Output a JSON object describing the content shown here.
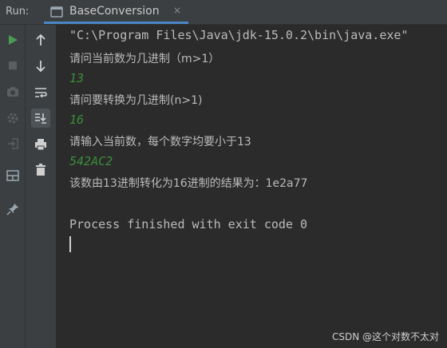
{
  "run": {
    "label": "Run:",
    "tab_title": "BaseConversion",
    "close_glyph": "×"
  },
  "toolbar_left": [
    {
      "icon": "run-icon",
      "color": "#499c54"
    },
    {
      "icon": "stop-icon"
    },
    {
      "icon": "camera-icon"
    },
    {
      "icon": "settings-icon"
    },
    {
      "icon": "login-icon"
    },
    {
      "icon": "layout-icon"
    },
    {
      "icon": "pin-icon"
    }
  ],
  "toolbar_right": [
    {
      "icon": "arrow-up-icon"
    },
    {
      "icon": "arrow-down-icon"
    },
    {
      "icon": "soft-wrap-icon"
    },
    {
      "icon": "scroll-to-end-icon"
    },
    {
      "icon": "print-icon"
    },
    {
      "icon": "trash-icon"
    }
  ],
  "console": {
    "command": "\"C:\\Program Files\\Java\\jdk-15.0.2\\bin\\java.exe\"",
    "prompt1": "请问当前数为几进制（m>1）",
    "input1": "13",
    "prompt2": "请问要转换为几进制(n>1)",
    "input2": "16",
    "prompt3": "请输入当前数，每个数字均要小于13",
    "input3": "542AC2",
    "result": "该数由13进制转化为16进制的结果为：1e2a77",
    "finish": "Process finished with exit code 0"
  },
  "colors": {
    "input": "#3a8d3a",
    "text": "#bbbbbb",
    "accent": "#4a88c7"
  },
  "watermark": "CSDN @这个对数不太对"
}
